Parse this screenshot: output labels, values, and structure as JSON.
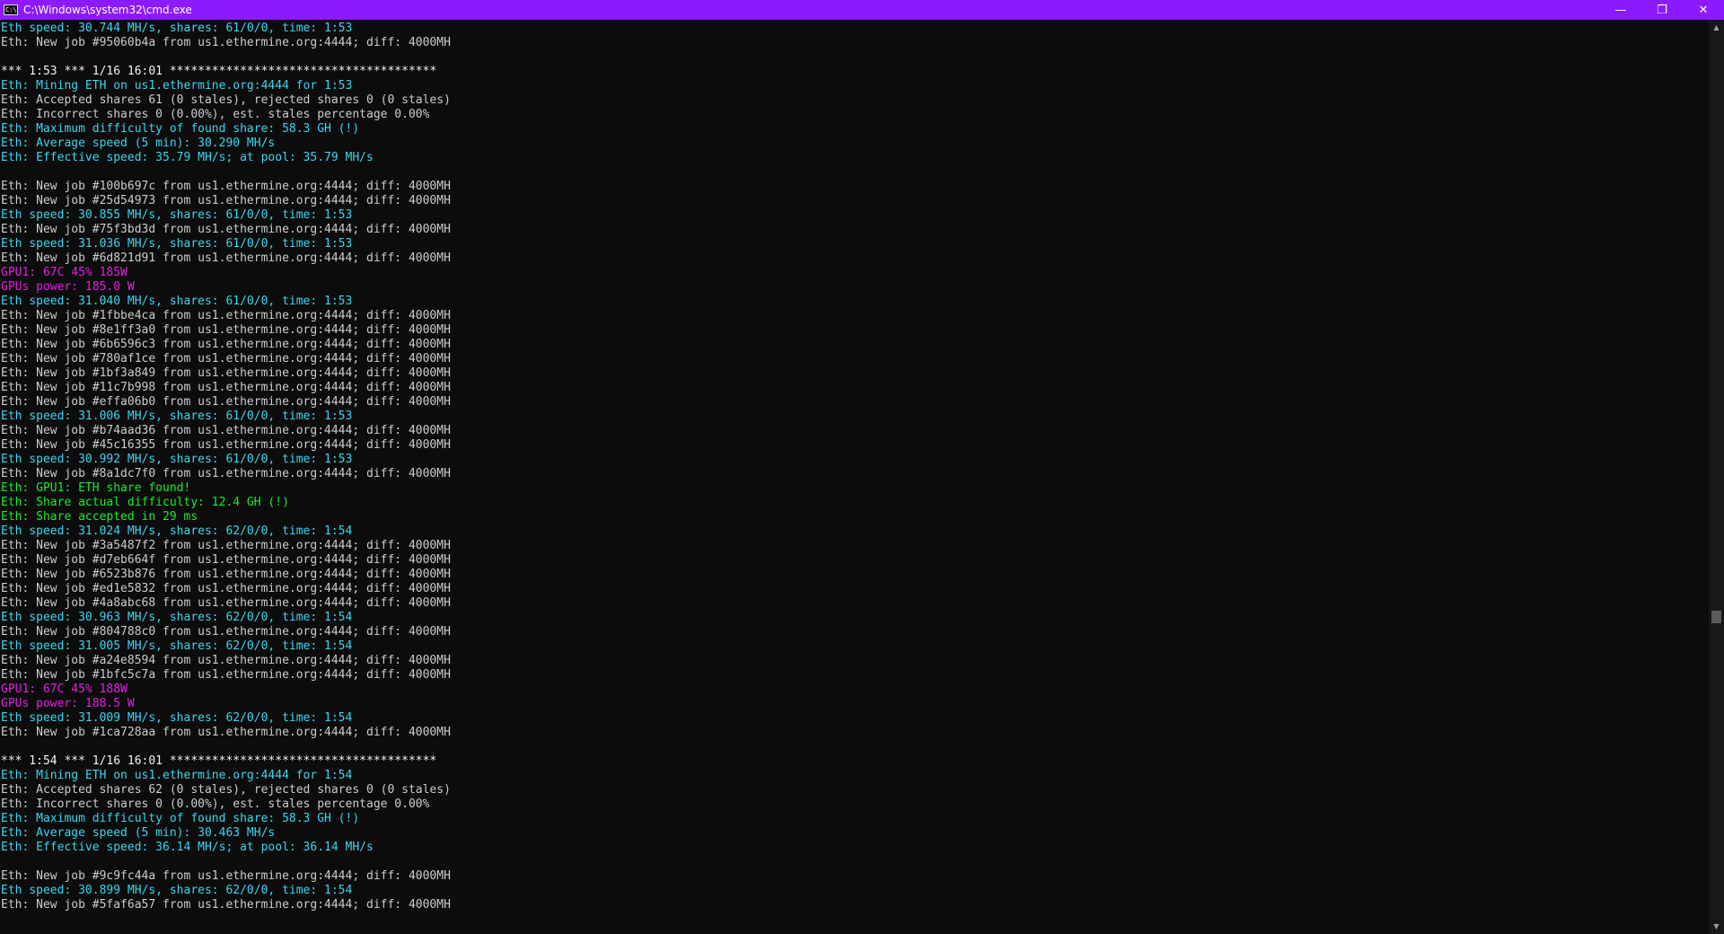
{
  "window": {
    "title": "C:\\Windows\\system32\\cmd.exe",
    "icon": "cmd-icon",
    "controls": {
      "minimize": "—",
      "restore": "❐",
      "close": "✕"
    }
  },
  "colors": {
    "titlebar": "#8c1aff",
    "gray": "#cccccc",
    "cyan": "#3ad6f0",
    "magenta": "#e61ee6",
    "green": "#17ee2b"
  },
  "console": {
    "lines": [
      {
        "text": "Eth speed: 30.744 MH/s, shares: 61/0/0, time: 1:53",
        "color": "cyan"
      },
      {
        "text": "Eth: New job #95060b4a from us1.ethermine.org:4444; diff: 4000MH",
        "color": "gray"
      },
      {
        "text": "",
        "color": "gray"
      },
      {
        "text": "*** 1:53 *** 1/16 16:01 **************************************",
        "color": "white"
      },
      {
        "text": "Eth: Mining ETH on us1.ethermine.org:4444 for 1:53",
        "color": "cyan"
      },
      {
        "text": "Eth: Accepted shares 61 (0 stales), rejected shares 0 (0 stales)",
        "color": "gray"
      },
      {
        "text": "Eth: Incorrect shares 0 (0.00%), est. stales percentage 0.00%",
        "color": "gray"
      },
      {
        "text": "Eth: Maximum difficulty of found share: 58.3 GH (!)",
        "color": "cyan"
      },
      {
        "text": "Eth: Average speed (5 min): 30.290 MH/s",
        "color": "cyan"
      },
      {
        "text": "Eth: Effective speed: 35.79 MH/s; at pool: 35.79 MH/s",
        "color": "cyan"
      },
      {
        "text": "",
        "color": "gray"
      },
      {
        "text": "Eth: New job #100b697c from us1.ethermine.org:4444; diff: 4000MH",
        "color": "gray"
      },
      {
        "text": "Eth: New job #25d54973 from us1.ethermine.org:4444; diff: 4000MH",
        "color": "gray"
      },
      {
        "text": "Eth speed: 30.855 MH/s, shares: 61/0/0, time: 1:53",
        "color": "cyan"
      },
      {
        "text": "Eth: New job #75f3bd3d from us1.ethermine.org:4444; diff: 4000MH",
        "color": "gray"
      },
      {
        "text": "Eth speed: 31.036 MH/s, shares: 61/0/0, time: 1:53",
        "color": "cyan"
      },
      {
        "text": "Eth: New job #6d821d91 from us1.ethermine.org:4444; diff: 4000MH",
        "color": "gray"
      },
      {
        "text": "GPU1: 67C 45% 185W",
        "color": "magenta"
      },
      {
        "text": "GPUs power: 185.0 W",
        "color": "magenta"
      },
      {
        "text": "Eth speed: 31.040 MH/s, shares: 61/0/0, time: 1:53",
        "color": "cyan"
      },
      {
        "text": "Eth: New job #1fbbe4ca from us1.ethermine.org:4444; diff: 4000MH",
        "color": "gray"
      },
      {
        "text": "Eth: New job #8e1ff3a0 from us1.ethermine.org:4444; diff: 4000MH",
        "color": "gray"
      },
      {
        "text": "Eth: New job #6b6596c3 from us1.ethermine.org:4444; diff: 4000MH",
        "color": "gray"
      },
      {
        "text": "Eth: New job #780af1ce from us1.ethermine.org:4444; diff: 4000MH",
        "color": "gray"
      },
      {
        "text": "Eth: New job #1bf3a849 from us1.ethermine.org:4444; diff: 4000MH",
        "color": "gray"
      },
      {
        "text": "Eth: New job #11c7b998 from us1.ethermine.org:4444; diff: 4000MH",
        "color": "gray"
      },
      {
        "text": "Eth: New job #effa06b0 from us1.ethermine.org:4444; diff: 4000MH",
        "color": "gray"
      },
      {
        "text": "Eth speed: 31.006 MH/s, shares: 61/0/0, time: 1:53",
        "color": "cyan"
      },
      {
        "text": "Eth: New job #b74aad36 from us1.ethermine.org:4444; diff: 4000MH",
        "color": "gray"
      },
      {
        "text": "Eth: New job #45c16355 from us1.ethermine.org:4444; diff: 4000MH",
        "color": "gray"
      },
      {
        "text": "Eth speed: 30.992 MH/s, shares: 61/0/0, time: 1:53",
        "color": "cyan"
      },
      {
        "text": "Eth: New job #8a1dc7f0 from us1.ethermine.org:4444; diff: 4000MH",
        "color": "gray"
      },
      {
        "text": "Eth: GPU1: ETH share found!",
        "color": "green"
      },
      {
        "text": "Eth: Share actual difficulty: 12.4 GH (!)",
        "color": "green"
      },
      {
        "text": "Eth: Share accepted in 29 ms",
        "color": "green"
      },
      {
        "text": "Eth speed: 31.024 MH/s, shares: 62/0/0, time: 1:54",
        "color": "cyan"
      },
      {
        "text": "Eth: New job #3a5487f2 from us1.ethermine.org:4444; diff: 4000MH",
        "color": "gray"
      },
      {
        "text": "Eth: New job #d7eb664f from us1.ethermine.org:4444; diff: 4000MH",
        "color": "gray"
      },
      {
        "text": "Eth: New job #6523b876 from us1.ethermine.org:4444; diff: 4000MH",
        "color": "gray"
      },
      {
        "text": "Eth: New job #ed1e5832 from us1.ethermine.org:4444; diff: 4000MH",
        "color": "gray"
      },
      {
        "text": "Eth: New job #4a8abc68 from us1.ethermine.org:4444; diff: 4000MH",
        "color": "gray"
      },
      {
        "text": "Eth speed: 30.963 MH/s, shares: 62/0/0, time: 1:54",
        "color": "cyan"
      },
      {
        "text": "Eth: New job #804788c0 from us1.ethermine.org:4444; diff: 4000MH",
        "color": "gray"
      },
      {
        "text": "Eth speed: 31.005 MH/s, shares: 62/0/0, time: 1:54",
        "color": "cyan"
      },
      {
        "text": "Eth: New job #a24e8594 from us1.ethermine.org:4444; diff: 4000MH",
        "color": "gray"
      },
      {
        "text": "Eth: New job #1bfc5c7a from us1.ethermine.org:4444; diff: 4000MH",
        "color": "gray"
      },
      {
        "text": "GPU1: 67C 45% 188W",
        "color": "magenta"
      },
      {
        "text": "GPUs power: 188.5 W",
        "color": "magenta"
      },
      {
        "text": "Eth speed: 31.009 MH/s, shares: 62/0/0, time: 1:54",
        "color": "cyan"
      },
      {
        "text": "Eth: New job #1ca728aa from us1.ethermine.org:4444; diff: 4000MH",
        "color": "gray"
      },
      {
        "text": "",
        "color": "gray"
      },
      {
        "text": "*** 1:54 *** 1/16 16:01 **************************************",
        "color": "white"
      },
      {
        "text": "Eth: Mining ETH on us1.ethermine.org:4444 for 1:54",
        "color": "cyan"
      },
      {
        "text": "Eth: Accepted shares 62 (0 stales), rejected shares 0 (0 stales)",
        "color": "gray"
      },
      {
        "text": "Eth: Incorrect shares 0 (0.00%), est. stales percentage 0.00%",
        "color": "gray"
      },
      {
        "text": "Eth: Maximum difficulty of found share: 58.3 GH (!)",
        "color": "cyan"
      },
      {
        "text": "Eth: Average speed (5 min): 30.463 MH/s",
        "color": "cyan"
      },
      {
        "text": "Eth: Effective speed: 36.14 MH/s; at pool: 36.14 MH/s",
        "color": "cyan"
      },
      {
        "text": "",
        "color": "gray"
      },
      {
        "text": "Eth: New job #9c9fc44a from us1.ethermine.org:4444; diff: 4000MH",
        "color": "gray"
      },
      {
        "text": "Eth speed: 30.899 MH/s, shares: 62/0/0, time: 1:54",
        "color": "cyan"
      },
      {
        "text": "Eth: New job #5faf6a57 from us1.ethermine.org:4444; diff: 4000MH",
        "color": "gray"
      }
    ]
  },
  "scrollbar": {
    "up_arrow": "▲",
    "down_arrow": "▼"
  }
}
